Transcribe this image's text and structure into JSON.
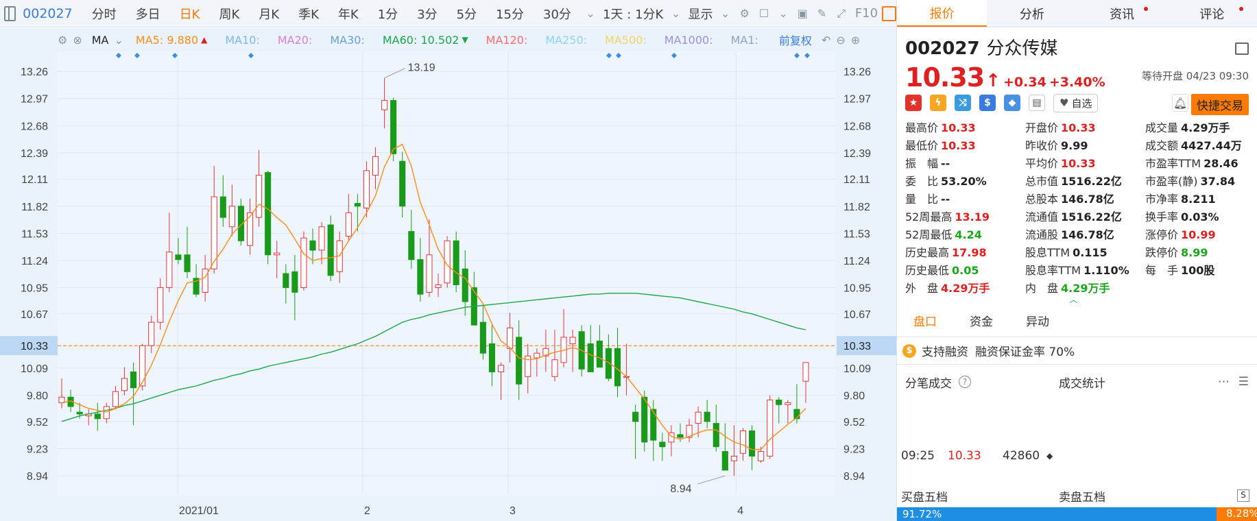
{
  "toolbar": {
    "code": "002027",
    "periods": [
      "分时",
      "多日",
      "日K",
      "周K",
      "月K",
      "季K",
      "年K",
      "1分",
      "3分",
      "5分",
      "15分",
      "30分"
    ],
    "active_period": "日K",
    "interval_select": "1天 : 1分K",
    "display_label": "显示",
    "f10_label": "F10"
  },
  "ma_bar": {
    "ma_label": "MA",
    "ma5": "MA5: 9.880",
    "ma10": "MA10:",
    "ma20": "MA20:",
    "ma30": "MA30:",
    "ma60": "MA60: 10.502",
    "ma120": "MA120:",
    "ma250": "MA250:",
    "ma500": "MA500:",
    "ma1000": "MA1000:",
    "ma1": "MA1:",
    "adjust_label": "前复权",
    "colors": {
      "ma5": "#ff8c1a",
      "ma10": "#7ab8e8",
      "ma20": "#d77fd6",
      "ma30": "#6aa0d8",
      "ma60": "#1aa64a",
      "ma120": "#ff6b6b",
      "ma250": "#8fd4f0",
      "ma500": "#f5d36a",
      "ma1000": "#9a8fe0",
      "ma1": "#8fa3c0"
    }
  },
  "chart": {
    "y_ticks": [
      "13.26",
      "12.97",
      "12.68",
      "12.39",
      "12.11",
      "11.82",
      "11.53",
      "11.24",
      "10.95",
      "10.67",
      "10.33",
      "10.09",
      "9.80",
      "9.52",
      "9.23",
      "8.94"
    ],
    "x_labels": [
      "2021/01",
      "2",
      "3",
      "4"
    ],
    "current_price_label": "10.33",
    "high_label": "13.19",
    "low_label": "8.94"
  },
  "chart_data": {
    "type": "candlestick",
    "ylim": [
      8.75,
      13.4
    ],
    "current_price": 10.33,
    "period_high": 13.19,
    "period_low": 8.94,
    "ohlc": [
      [
        9.72,
        9.98,
        9.66,
        9.78
      ],
      [
        9.78,
        9.86,
        9.62,
        9.68
      ],
      [
        9.62,
        9.72,
        9.55,
        9.6
      ],
      [
        9.58,
        9.65,
        9.48,
        9.6
      ],
      [
        9.6,
        9.72,
        9.42,
        9.55
      ],
      [
        9.55,
        9.72,
        9.5,
        9.68
      ],
      [
        9.68,
        9.9,
        9.65,
        9.84
      ],
      [
        9.85,
        10.1,
        9.8,
        9.98
      ],
      [
        10.05,
        10.15,
        9.48,
        9.88
      ],
      [
        9.9,
        10.35,
        9.85,
        10.33
      ],
      [
        10.33,
        10.65,
        10.25,
        10.58
      ],
      [
        10.58,
        11.05,
        10.5,
        10.95
      ],
      [
        10.95,
        11.75,
        10.9,
        11.33
      ],
      [
        11.3,
        11.48,
        11.2,
        11.25
      ],
      [
        11.3,
        11.6,
        11.05,
        11.12
      ],
      [
        11.05,
        11.2,
        10.85,
        10.88
      ],
      [
        10.9,
        11.3,
        10.8,
        11.15
      ],
      [
        11.15,
        12.25,
        11.1,
        11.92
      ],
      [
        11.92,
        12.15,
        11.6,
        11.7
      ],
      [
        11.6,
        12.05,
        11.5,
        11.82
      ],
      [
        11.82,
        11.9,
        11.4,
        11.45
      ],
      [
        11.4,
        11.9,
        11.3,
        11.75
      ],
      [
        11.7,
        12.42,
        11.6,
        12.15
      ],
      [
        12.18,
        12.2,
        11.2,
        11.3
      ],
      [
        11.3,
        11.45,
        11.05,
        11.32
      ],
      [
        11.1,
        11.2,
        10.78,
        10.95
      ],
      [
        11.12,
        11.3,
        10.6,
        10.9
      ],
      [
        10.95,
        11.55,
        10.92,
        11.48
      ],
      [
        11.45,
        11.58,
        11.2,
        11.35
      ],
      [
        11.35,
        11.65,
        11.2,
        11.6
      ],
      [
        11.62,
        11.72,
        11.02,
        11.08
      ],
      [
        11.12,
        11.55,
        11.0,
        11.45
      ],
      [
        11.5,
        11.95,
        11.45,
        11.75
      ],
      [
        11.85,
        11.95,
        11.55,
        11.82
      ],
      [
        11.8,
        12.3,
        11.7,
        12.2
      ],
      [
        12.15,
        12.45,
        12.0,
        12.35
      ],
      [
        12.85,
        13.19,
        12.65,
        12.95
      ],
      [
        12.95,
        12.98,
        12.3,
        12.38
      ],
      [
        12.3,
        12.4,
        11.7,
        11.82
      ],
      [
        11.55,
        11.78,
        11.15,
        11.25
      ],
      [
        11.25,
        11.48,
        10.8,
        10.88
      ],
      [
        10.9,
        11.68,
        10.85,
        11.3
      ],
      [
        10.95,
        11.1,
        10.85,
        10.98
      ],
      [
        11.0,
        11.5,
        10.95,
        11.45
      ],
      [
        11.45,
        11.55,
        10.9,
        10.98
      ],
      [
        11.15,
        11.35,
        10.65,
        10.8
      ],
      [
        10.95,
        11.12,
        10.6,
        10.55
      ],
      [
        10.58,
        10.78,
        10.18,
        10.25
      ],
      [
        10.35,
        10.55,
        9.9,
        10.05
      ],
      [
        10.05,
        10.15,
        9.75,
        10.12
      ],
      [
        10.3,
        10.68,
        10.15,
        10.52
      ],
      [
        10.42,
        10.6,
        9.75,
        9.92
      ],
      [
        10.0,
        10.35,
        9.82,
        10.22
      ],
      [
        10.2,
        10.3,
        10.0,
        10.25
      ],
      [
        10.22,
        10.5,
        10.05,
        10.3
      ],
      [
        10.0,
        10.5,
        9.95,
        10.18
      ],
      [
        10.15,
        10.72,
        10.1,
        10.42
      ],
      [
        10.35,
        10.5,
        10.05,
        10.42
      ],
      [
        10.48,
        10.55,
        10.0,
        10.08
      ],
      [
        10.35,
        10.55,
        10.05,
        10.05
      ],
      [
        10.38,
        10.55,
        10.2,
        10.1
      ],
      [
        10.3,
        10.45,
        9.95,
        9.98
      ],
      [
        10.3,
        10.52,
        9.78,
        9.9
      ],
      [
        10.0,
        10.35,
        9.8,
        10.0
      ],
      [
        9.62,
        9.7,
        9.12,
        9.52
      ],
      [
        9.78,
        9.85,
        9.2,
        9.3
      ],
      [
        9.65,
        9.75,
        9.1,
        9.32
      ],
      [
        9.3,
        9.4,
        9.1,
        9.25
      ],
      [
        9.3,
        9.48,
        9.15,
        9.4
      ],
      [
        9.38,
        9.5,
        9.3,
        9.35
      ],
      [
        9.35,
        9.55,
        9.3,
        9.48
      ],
      [
        9.5,
        9.68,
        9.35,
        9.62
      ],
      [
        9.62,
        9.75,
        9.45,
        9.52
      ],
      [
        9.5,
        9.7,
        9.2,
        9.25
      ],
      [
        9.2,
        9.5,
        9.0,
        9.0
      ],
      [
        9.1,
        9.48,
        8.94,
        9.15
      ],
      [
        9.18,
        9.45,
        9.1,
        9.42
      ],
      [
        9.42,
        9.48,
        9.0,
        9.15
      ],
      [
        9.1,
        9.25,
        9.08,
        9.2
      ],
      [
        9.15,
        9.8,
        9.12,
        9.75
      ],
      [
        9.75,
        9.78,
        9.5,
        9.7
      ],
      [
        9.7,
        9.75,
        9.5,
        9.72
      ],
      [
        9.65,
        9.92,
        9.5,
        9.55
      ],
      [
        9.95,
        10.15,
        9.72,
        10.15
      ]
    ],
    "ma5": [
      9.72,
      9.74,
      9.7,
      9.66,
      9.64,
      9.62,
      9.66,
      9.71,
      9.79,
      9.94,
      10.12,
      10.34,
      10.59,
      10.81,
      11.0,
      11.02,
      11.06,
      11.23,
      11.36,
      11.52,
      11.62,
      11.71,
      11.84,
      11.79,
      11.7,
      11.62,
      11.47,
      11.31,
      11.24,
      11.26,
      11.27,
      11.29,
      11.45,
      11.59,
      11.75,
      11.93,
      12.24,
      12.43,
      12.48,
      12.25,
      11.86,
      11.62,
      11.36,
      11.19,
      11.11,
      11.05,
      10.91,
      10.78,
      10.56,
      10.38,
      10.31,
      10.2,
      10.18,
      10.19,
      10.23,
      10.26,
      10.28,
      10.31,
      10.28,
      10.23,
      10.2,
      10.15,
      10.08,
      10.0,
      9.88,
      9.76,
      9.62,
      9.48,
      9.36,
      9.33,
      9.36,
      9.4,
      9.43,
      9.43,
      9.36,
      9.3,
      9.27,
      9.22,
      9.22,
      9.33,
      9.41,
      9.49,
      9.56,
      9.66
    ],
    "ma60": [
      9.52,
      9.55,
      9.58,
      9.6,
      9.62,
      9.64,
      9.66,
      9.69,
      9.71,
      9.74,
      9.77,
      9.8,
      9.83,
      9.86,
      9.88,
      9.9,
      9.93,
      9.96,
      9.98,
      10.01,
      10.03,
      10.06,
      10.08,
      10.11,
      10.13,
      10.15,
      10.17,
      10.19,
      10.21,
      10.24,
      10.26,
      10.29,
      10.32,
      10.35,
      10.39,
      10.43,
      10.48,
      10.53,
      10.58,
      10.61,
      10.63,
      10.66,
      10.68,
      10.7,
      10.72,
      10.74,
      10.75,
      10.76,
      10.77,
      10.78,
      10.79,
      10.8,
      10.81,
      10.82,
      10.83,
      10.84,
      10.85,
      10.86,
      10.87,
      10.88,
      10.88,
      10.89,
      10.89,
      10.89,
      10.89,
      10.88,
      10.87,
      10.86,
      10.85,
      10.84,
      10.82,
      10.8,
      10.78,
      10.76,
      10.74,
      10.72,
      10.69,
      10.67,
      10.64,
      10.61,
      10.58,
      10.55,
      10.52,
      10.5
    ]
  },
  "right_panel": {
    "tabs": [
      "报价",
      "分析",
      "资讯",
      "评论"
    ],
    "active_tab": "报价",
    "code": "002027",
    "name": "分众传媒",
    "price": "10.33",
    "change": "+0.34",
    "change_pct": "+3.40%",
    "status": "等待开盘 04/23 09:30",
    "watch_label": "自选",
    "quick_trade_label": "快捷交易",
    "stats": [
      {
        "label": "最高价",
        "value": "10.33",
        "color": "red"
      },
      {
        "label": "开盘价",
        "value": "10.33",
        "color": "red"
      },
      {
        "label": "成交量",
        "value": "4.29万手",
        "color": "dark"
      },
      {
        "label": "最低价",
        "value": "10.33",
        "color": "red"
      },
      {
        "label": "昨收价",
        "value": "9.99",
        "color": "dark"
      },
      {
        "label": "成交额",
        "value": "4427.44万",
        "color": "dark"
      },
      {
        "label": "振　幅",
        "value": "--",
        "color": "dark"
      },
      {
        "label": "平均价",
        "value": "10.33",
        "color": "red"
      },
      {
        "label": "市盈率TTM",
        "value": "28.46",
        "color": "dark"
      },
      {
        "label": "委　比",
        "value": "53.20%",
        "color": "dark"
      },
      {
        "label": "总市值",
        "value": "1516.22亿",
        "color": "dark"
      },
      {
        "label": "市盈率(静)",
        "value": "37.84",
        "color": "dark"
      },
      {
        "label": "量　比",
        "value": "--",
        "color": "dark"
      },
      {
        "label": "总股本",
        "value": "146.78亿",
        "color": "dark"
      },
      {
        "label": "市净率",
        "value": "8.211",
        "color": "dark"
      },
      {
        "label": "52周最高",
        "value": "13.19",
        "color": "red"
      },
      {
        "label": "流通值",
        "value": "1516.22亿",
        "color": "dark"
      },
      {
        "label": "换手率",
        "value": "0.03%",
        "color": "dark"
      },
      {
        "label": "52周最低",
        "value": "4.24",
        "color": "green"
      },
      {
        "label": "流通股",
        "value": "146.78亿",
        "color": "dark"
      },
      {
        "label": "涨停价",
        "value": "10.99",
        "color": "red"
      },
      {
        "label": "历史最高",
        "value": "17.98",
        "color": "red"
      },
      {
        "label": "股息TTM",
        "value": "0.115",
        "color": "dark"
      },
      {
        "label": "跌停价",
        "value": "8.99",
        "color": "green"
      },
      {
        "label": "历史最低",
        "value": "0.05",
        "color": "green"
      },
      {
        "label": "股息率TTM",
        "value": "1.110%",
        "color": "dark"
      },
      {
        "label": "每　手",
        "value": "100股",
        "color": "dark"
      },
      {
        "label": "外　盘",
        "value": "4.29万手",
        "color": "red"
      },
      {
        "label": "内　盘",
        "value": "4.29万手",
        "color": "green"
      }
    ],
    "sub_tabs": [
      "盘口",
      "资金",
      "异动"
    ],
    "active_sub_tab": "盘口",
    "margin_label": "支持融资",
    "margin_rate": "融资保证金率 70%",
    "ticks_label": "分笔成交",
    "deal_stats_label": "成交统计",
    "tick": {
      "time": "09:25",
      "price": "10.33",
      "volume": "42860"
    },
    "bid_label": "买盘五档",
    "ask_label": "卖盘五档",
    "bid_ratio": "91.72%",
    "ask_ratio": "8.28%"
  }
}
